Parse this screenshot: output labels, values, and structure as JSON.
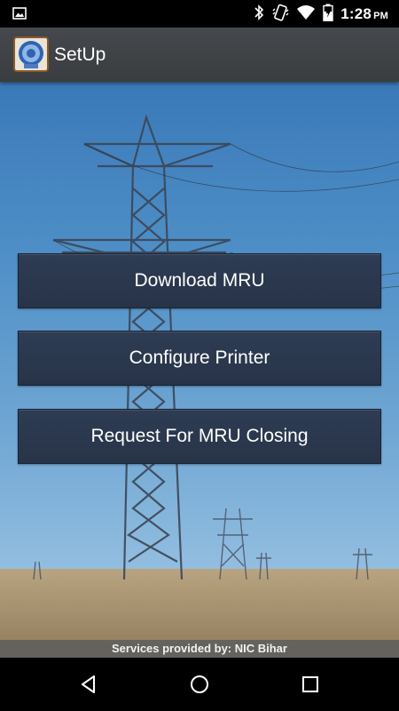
{
  "status_bar": {
    "time": "1:28",
    "ampm": "PM",
    "icons": [
      "image-notification-icon",
      "bluetooth-icon",
      "vibrate-icon",
      "wifi-icon",
      "battery-charging-icon"
    ]
  },
  "app_bar": {
    "title": "SetUp",
    "logo_icon": "app-logo-icon"
  },
  "buttons": {
    "download_mru": "Download MRU",
    "configure_printer": "Configure Printer",
    "request_mru_closing": "Request For MRU Closing"
  },
  "footer": {
    "text": "Services provided by: NIC Bihar"
  },
  "nav_bar": {
    "icons": [
      "back-icon",
      "home-icon",
      "recents-icon"
    ]
  },
  "colors": {
    "button_bg": "#2b3850",
    "app_bar_bg": "#404347",
    "sky": "#4f8fc7",
    "footer_bg": "#5f5f5f"
  }
}
